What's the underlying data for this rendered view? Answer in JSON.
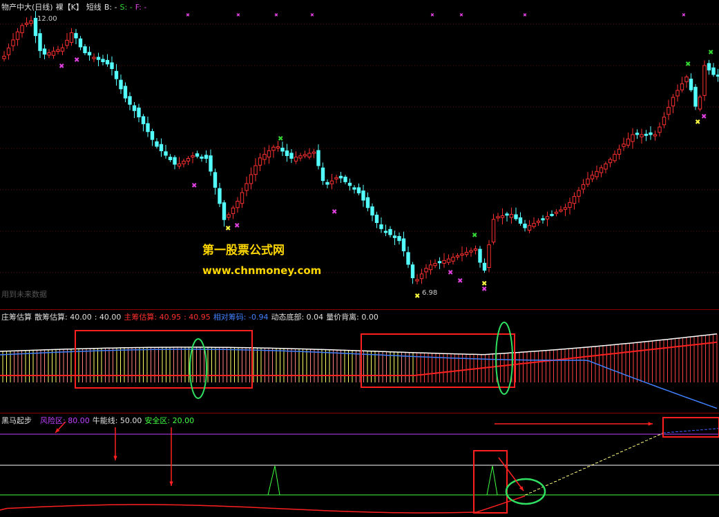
{
  "main": {
    "title": "物产中大(日线)",
    "mode1": "裸【K】",
    "mode2": "短线",
    "b_label": "B: -",
    "s_label": "S: -",
    "f_label": "F: -",
    "high_label": "12.00",
    "low_label": "6.98",
    "watermark_cn": "第一股票公式网",
    "watermark_url": "www.chnmoney.com",
    "note": "用到未来数据",
    "colors": {
      "up": "#ff3030",
      "down": "#54ffff",
      "b": "#ffffff",
      "s": "#34d834",
      "f": "#e040e0"
    }
  },
  "indicator1": {
    "name": "庄筹估算",
    "items": [
      {
        "label": "散筹估算: 40.00",
        "color": "#e0e0e0"
      },
      {
        "label": ": 40.00",
        "color": "#e0e0e0"
      },
      {
        "label": "主筹估算: 40.95",
        "color": "#ff3030"
      },
      {
        "label": ": 40.95",
        "color": "#ff3030"
      },
      {
        "label": "相对筹码: -0.94",
        "color": "#4080ff"
      },
      {
        "label": "动态底部: 0.04",
        "color": "#e0e0e0"
      },
      {
        "label": "量价背离: 0.00",
        "color": "#e0e0e0"
      }
    ]
  },
  "indicator2": {
    "name": "黑马起步",
    "items": [
      {
        "label": "风险区: 80.00",
        "color": "#c040ff"
      },
      {
        "label": "牛能线: 50.00",
        "color": "#e0e0e0"
      },
      {
        "label": "安全区: 20.00",
        "color": "#40ff40"
      }
    ]
  }
}
